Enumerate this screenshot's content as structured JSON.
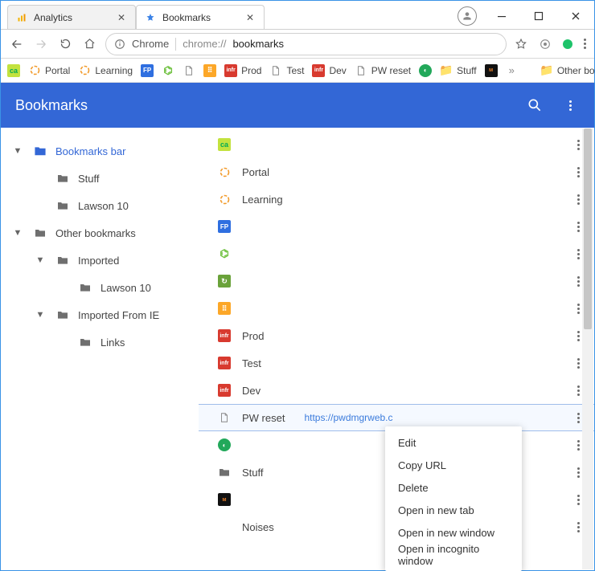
{
  "window": {
    "tabs": [
      {
        "label": "Analytics",
        "active": false,
        "icon": "analytics"
      },
      {
        "label": "Bookmarks",
        "active": true,
        "icon": "star"
      }
    ]
  },
  "omnibox": {
    "scheme_label": "Chrome",
    "url_prefix": "chrome://",
    "url_bold": "bookmarks"
  },
  "bookmarks_bar": {
    "items": [
      {
        "icon": "ca",
        "label": ""
      },
      {
        "icon": "port",
        "label": "Portal"
      },
      {
        "icon": "port",
        "label": "Learning"
      },
      {
        "icon": "fp",
        "label": ""
      },
      {
        "icon": "s",
        "label": ""
      },
      {
        "icon": "doc",
        "label": ""
      },
      {
        "icon": "og",
        "label": ""
      },
      {
        "icon": "red",
        "label": "Prod"
      },
      {
        "icon": "doc",
        "label": "Test"
      },
      {
        "icon": "red",
        "label": "Dev"
      },
      {
        "icon": "doc",
        "label": "PW reset"
      },
      {
        "icon": "grn",
        "label": ""
      },
      {
        "icon": "fold",
        "label": "Stuff"
      },
      {
        "icon": "mw",
        "label": ""
      }
    ],
    "overflow_label": "Other bookmarks"
  },
  "page_header": {
    "title": "Bookmarks"
  },
  "tree": {
    "nodes": [
      {
        "indent": 0,
        "expander": "down",
        "icon": "folder-open",
        "label": "Bookmarks bar",
        "selected": true
      },
      {
        "indent": 1,
        "expander": "",
        "icon": "folder",
        "label": "Stuff",
        "selected": false
      },
      {
        "indent": 1,
        "expander": "",
        "icon": "folder",
        "label": "Lawson 10",
        "selected": false
      },
      {
        "indent": 0,
        "expander": "down",
        "icon": "folder",
        "label": "Other bookmarks",
        "selected": false
      },
      {
        "indent": 1,
        "expander": "down",
        "icon": "folder",
        "label": "Imported",
        "selected": false
      },
      {
        "indent": 2,
        "expander": "",
        "icon": "folder",
        "label": "Lawson 10",
        "selected": false
      },
      {
        "indent": 1,
        "expander": "down",
        "icon": "folder",
        "label": "Imported From IE",
        "selected": false
      },
      {
        "indent": 2,
        "expander": "",
        "icon": "folder",
        "label": "Links",
        "selected": false
      }
    ]
  },
  "list": {
    "rows": [
      {
        "icon": "ca",
        "name": "",
        "url": ""
      },
      {
        "icon": "port",
        "name": "Portal",
        "url": ""
      },
      {
        "icon": "port",
        "name": "Learning",
        "url": ""
      },
      {
        "icon": "fp",
        "name": "",
        "url": ""
      },
      {
        "icon": "s",
        "name": "",
        "url": ""
      },
      {
        "icon": "vg",
        "name": "",
        "url": ""
      },
      {
        "icon": "og",
        "name": "",
        "url": ""
      },
      {
        "icon": "red",
        "name": "Prod",
        "url": ""
      },
      {
        "icon": "red",
        "name": "Test",
        "url": ""
      },
      {
        "icon": "red",
        "name": "Dev",
        "url": ""
      },
      {
        "icon": "doc",
        "name": "PW reset",
        "url": "https://pwdmgrweb.c",
        "highlight": true
      },
      {
        "icon": "grn",
        "name": "",
        "url": ""
      },
      {
        "icon": "fold-g",
        "name": "Stuff",
        "url": ""
      },
      {
        "icon": "mw",
        "name": "",
        "url": ""
      },
      {
        "icon": "blank",
        "name": "Noises",
        "url": ""
      }
    ]
  },
  "context_menu": {
    "items": [
      "Edit",
      "Copy URL",
      "Delete",
      "Open in new tab",
      "Open in new window",
      "Open in incognito window"
    ]
  }
}
